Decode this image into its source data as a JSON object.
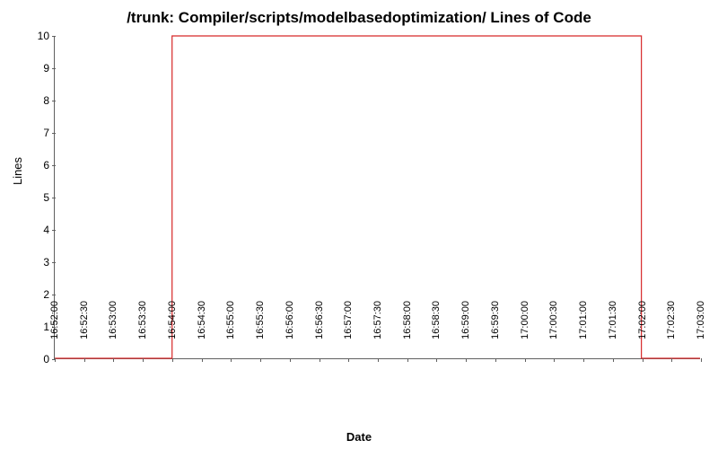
{
  "chart_data": {
    "type": "line",
    "title": "/trunk: Compiler/scripts/modelbasedoptimization/ Lines of Code",
    "xlabel": "Date",
    "ylabel": "Lines",
    "ylim": [
      0,
      10
    ],
    "y_ticks": [
      0,
      1,
      2,
      3,
      4,
      5,
      6,
      7,
      8,
      9,
      10
    ],
    "x_ticks": [
      "16:52:00",
      "16:52:30",
      "16:53:00",
      "16:53:30",
      "16:54:00",
      "16:54:30",
      "16:55:00",
      "16:55:30",
      "16:56:00",
      "16:56:30",
      "16:57:00",
      "16:57:30",
      "16:58:00",
      "16:58:30",
      "16:59:00",
      "16:59:30",
      "17:00:00",
      "17:00:30",
      "17:01:00",
      "17:01:30",
      "17:02:00",
      "17:02:30",
      "17:03:00"
    ],
    "series": [
      {
        "name": "Lines of Code",
        "color": "#d62728",
        "x": [
          "16:52:00",
          "16:52:30",
          "16:53:00",
          "16:53:30",
          "16:54:00",
          "16:54:00",
          "16:54:30",
          "16:55:00",
          "16:55:30",
          "16:56:00",
          "16:56:30",
          "16:57:00",
          "16:57:30",
          "16:58:00",
          "16:58:30",
          "16:59:00",
          "16:59:30",
          "17:00:00",
          "17:00:30",
          "17:01:00",
          "17:01:30",
          "17:02:00",
          "17:02:00",
          "17:02:30",
          "17:03:00"
        ],
        "y": [
          0,
          0,
          0,
          0,
          0,
          10,
          10,
          10,
          10,
          10,
          10,
          10,
          10,
          10,
          10,
          10,
          10,
          10,
          10,
          10,
          10,
          10,
          0,
          0,
          0
        ]
      }
    ]
  }
}
